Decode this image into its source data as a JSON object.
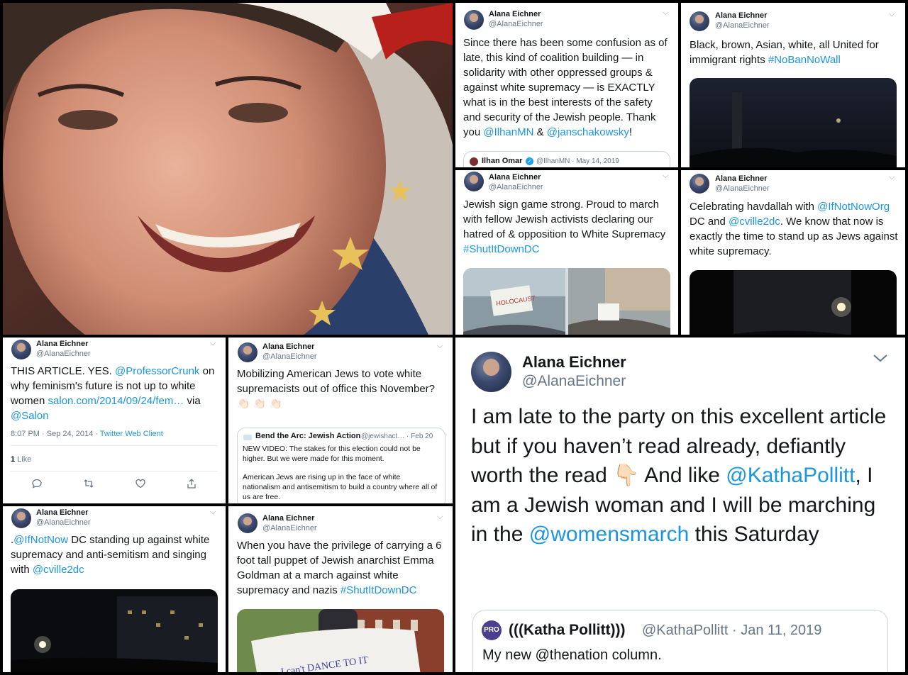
{
  "tweets": {
    "t1": {
      "name": "Alana Eichner",
      "handle": "@AlanaEichner",
      "text_a": "Since there has been some confusion as of late, this kind of coalition building — in solidarity with other oppressed groups & against white supremacy — is EXACTLY what is in the best interests of the safety and security of the Jewish people. Thank you ",
      "mention1": "@IlhanMN",
      "amp": " & ",
      "mention2": "@janschakowsky",
      "end": "!",
      "quote_name": "Ilhan Omar",
      "quote_meta": "@IlhanMN · May 14, 2019"
    },
    "t2": {
      "name": "Alana Eichner",
      "handle": "@AlanaEichner",
      "text": "Black, brown, Asian, white, all United for immigrant rights ",
      "hashtag": "#NoBanNoWall"
    },
    "t3": {
      "name": "Alana Eichner",
      "handle": "@AlanaEichner",
      "text": "Jewish sign game strong. Proud to march with fellow Jewish activists declaring our hatred of & opposition to White Supremacy ",
      "hashtag": "#ShutItDownDC",
      "sign_text": "HOLOCAUST"
    },
    "t4": {
      "name": "Alana Eichner",
      "handle": "@AlanaEichner",
      "text_a": "Celebrating havdallah with ",
      "mention1": "@IfNotNowOrg",
      "text_b": " DC and ",
      "mention2": "@cville2dc",
      "text_c": ". We know that now is exactly the time to stand up as Jews against white supremacy."
    },
    "t5": {
      "name": "Alana Eichner",
      "handle": "@AlanaEichner",
      "text_a": "THIS ARTICLE. YES. ",
      "mention1": "@ProfessorCrunk",
      "text_b": " on why feminism's future is not up to white women ",
      "link": "salon.com/2014/09/24/fem…",
      "text_c": " via ",
      "mention2": "@Salon",
      "meta": "8:07 PM · Sep 24, 2014 · ",
      "client": "Twitter Web Client",
      "likes_count": "1",
      "likes_label": " Like"
    },
    "t6": {
      "name": "Alana Eichner",
      "handle": "@AlanaEichner",
      "text": "Mobilizing American Jews to vote white supremacists out of office this November?",
      "emoji": "👏🏻 👏🏻 👏🏻",
      "quote_name": "Bend the Arc: Jewish Action",
      "quote_handle": "@jewishact… · Feb 20",
      "quote_p1": "NEW VIDEO: The stakes for this election could not be higher. But we were made for this moment.",
      "quote_p2": "American Jews are rising up in the face of white nationalism and antisemitism to build a country where all of us are free."
    },
    "t7": {
      "name": "Alana Eichner",
      "handle": "@AlanaEichner",
      "prefix": ".",
      "mention1": "@IfNotNow",
      "text_a": " DC standing up against white supremacy and anti-semitism and singing with ",
      "mention2": "@cville2dc"
    },
    "t8": {
      "name": "Alana Eichner",
      "handle": "@AlanaEichner",
      "text": "When you have the privilege of carrying a 6 foot tall puppet of Jewish anarchist Emma Goldman at a march against white supremacy and nazis ",
      "hashtag": "#ShutItDownDC",
      "banner_text": "I can't DANCE TO IT"
    },
    "t9": {
      "name": "Alana Eichner",
      "handle": "@AlanaEichner",
      "text_a": "I am late to the party on this excellent article but if you haven’t read already, defiantly worth the read ",
      "emoji": "👇🏻",
      "text_b": " And like ",
      "mention1": "@KathaPollitt",
      "text_c": ", I am a Jewish woman and I will be marching in the ",
      "mention2": "@womensmarch",
      "text_d": " this Saturday",
      "quote_badge": "PRO",
      "quote_name": "(((Katha Pollitt)))",
      "quote_meta": "@KathaPollitt · Jan 11, 2019",
      "quote_text": "My new @thenation column."
    }
  },
  "colors": {
    "link": "#1b95e0",
    "text": "#14171a",
    "muted": "#657786",
    "gutter": "#000000"
  }
}
